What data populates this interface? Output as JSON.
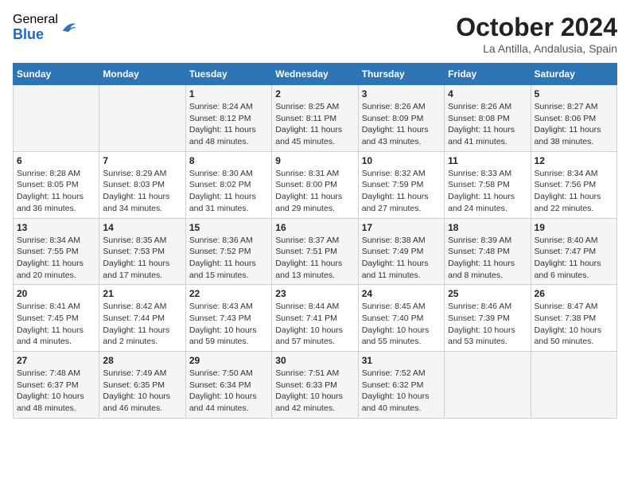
{
  "header": {
    "logo_general": "General",
    "logo_blue": "Blue",
    "title": "October 2024",
    "location": "La Antilla, Andalusia, Spain"
  },
  "days_of_week": [
    "Sunday",
    "Monday",
    "Tuesday",
    "Wednesday",
    "Thursday",
    "Friday",
    "Saturday"
  ],
  "weeks": [
    [
      {
        "day": null,
        "content": null
      },
      {
        "day": null,
        "content": null
      },
      {
        "day": "1",
        "content": "Sunrise: 8:24 AM\nSunset: 8:12 PM\nDaylight: 11 hours and 48 minutes."
      },
      {
        "day": "2",
        "content": "Sunrise: 8:25 AM\nSunset: 8:11 PM\nDaylight: 11 hours and 45 minutes."
      },
      {
        "day": "3",
        "content": "Sunrise: 8:26 AM\nSunset: 8:09 PM\nDaylight: 11 hours and 43 minutes."
      },
      {
        "day": "4",
        "content": "Sunrise: 8:26 AM\nSunset: 8:08 PM\nDaylight: 11 hours and 41 minutes."
      },
      {
        "day": "5",
        "content": "Sunrise: 8:27 AM\nSunset: 8:06 PM\nDaylight: 11 hours and 38 minutes."
      }
    ],
    [
      {
        "day": "6",
        "content": "Sunrise: 8:28 AM\nSunset: 8:05 PM\nDaylight: 11 hours and 36 minutes."
      },
      {
        "day": "7",
        "content": "Sunrise: 8:29 AM\nSunset: 8:03 PM\nDaylight: 11 hours and 34 minutes."
      },
      {
        "day": "8",
        "content": "Sunrise: 8:30 AM\nSunset: 8:02 PM\nDaylight: 11 hours and 31 minutes."
      },
      {
        "day": "9",
        "content": "Sunrise: 8:31 AM\nSunset: 8:00 PM\nDaylight: 11 hours and 29 minutes."
      },
      {
        "day": "10",
        "content": "Sunrise: 8:32 AM\nSunset: 7:59 PM\nDaylight: 11 hours and 27 minutes."
      },
      {
        "day": "11",
        "content": "Sunrise: 8:33 AM\nSunset: 7:58 PM\nDaylight: 11 hours and 24 minutes."
      },
      {
        "day": "12",
        "content": "Sunrise: 8:34 AM\nSunset: 7:56 PM\nDaylight: 11 hours and 22 minutes."
      }
    ],
    [
      {
        "day": "13",
        "content": "Sunrise: 8:34 AM\nSunset: 7:55 PM\nDaylight: 11 hours and 20 minutes."
      },
      {
        "day": "14",
        "content": "Sunrise: 8:35 AM\nSunset: 7:53 PM\nDaylight: 11 hours and 17 minutes."
      },
      {
        "day": "15",
        "content": "Sunrise: 8:36 AM\nSunset: 7:52 PM\nDaylight: 11 hours and 15 minutes."
      },
      {
        "day": "16",
        "content": "Sunrise: 8:37 AM\nSunset: 7:51 PM\nDaylight: 11 hours and 13 minutes."
      },
      {
        "day": "17",
        "content": "Sunrise: 8:38 AM\nSunset: 7:49 PM\nDaylight: 11 hours and 11 minutes."
      },
      {
        "day": "18",
        "content": "Sunrise: 8:39 AM\nSunset: 7:48 PM\nDaylight: 11 hours and 8 minutes."
      },
      {
        "day": "19",
        "content": "Sunrise: 8:40 AM\nSunset: 7:47 PM\nDaylight: 11 hours and 6 minutes."
      }
    ],
    [
      {
        "day": "20",
        "content": "Sunrise: 8:41 AM\nSunset: 7:45 PM\nDaylight: 11 hours and 4 minutes."
      },
      {
        "day": "21",
        "content": "Sunrise: 8:42 AM\nSunset: 7:44 PM\nDaylight: 11 hours and 2 minutes."
      },
      {
        "day": "22",
        "content": "Sunrise: 8:43 AM\nSunset: 7:43 PM\nDaylight: 10 hours and 59 minutes."
      },
      {
        "day": "23",
        "content": "Sunrise: 8:44 AM\nSunset: 7:41 PM\nDaylight: 10 hours and 57 minutes."
      },
      {
        "day": "24",
        "content": "Sunrise: 8:45 AM\nSunset: 7:40 PM\nDaylight: 10 hours and 55 minutes."
      },
      {
        "day": "25",
        "content": "Sunrise: 8:46 AM\nSunset: 7:39 PM\nDaylight: 10 hours and 53 minutes."
      },
      {
        "day": "26",
        "content": "Sunrise: 8:47 AM\nSunset: 7:38 PM\nDaylight: 10 hours and 50 minutes."
      }
    ],
    [
      {
        "day": "27",
        "content": "Sunrise: 7:48 AM\nSunset: 6:37 PM\nDaylight: 10 hours and 48 minutes."
      },
      {
        "day": "28",
        "content": "Sunrise: 7:49 AM\nSunset: 6:35 PM\nDaylight: 10 hours and 46 minutes."
      },
      {
        "day": "29",
        "content": "Sunrise: 7:50 AM\nSunset: 6:34 PM\nDaylight: 10 hours and 44 minutes."
      },
      {
        "day": "30",
        "content": "Sunrise: 7:51 AM\nSunset: 6:33 PM\nDaylight: 10 hours and 42 minutes."
      },
      {
        "day": "31",
        "content": "Sunrise: 7:52 AM\nSunset: 6:32 PM\nDaylight: 10 hours and 40 minutes."
      },
      {
        "day": null,
        "content": null
      },
      {
        "day": null,
        "content": null
      }
    ]
  ]
}
